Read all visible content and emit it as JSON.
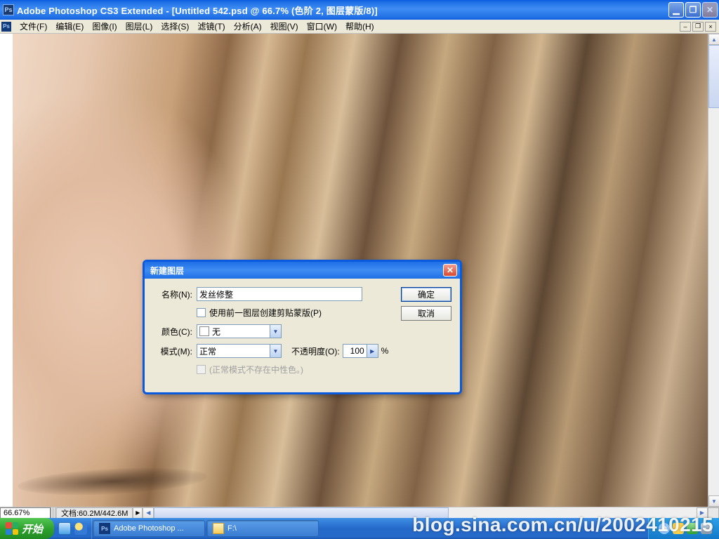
{
  "titlebar": {
    "app_icon": "Ps",
    "title": "Adobe Photoshop CS3 Extended - [Untitled 542.psd @ 66.7% (色阶 2, 图层蒙版/8)]"
  },
  "menu": {
    "items": [
      "文件(F)",
      "编辑(E)",
      "图像(I)",
      "图层(L)",
      "选择(S)",
      "滤镜(T)",
      "分析(A)",
      "视图(V)",
      "窗口(W)",
      "帮助(H)"
    ]
  },
  "status": {
    "zoom": "66.67%",
    "docinfo": "文档:60.2M/442.6M"
  },
  "dialog": {
    "title": "新建图层",
    "name_label": "名称(N):",
    "name_value": "发丝修整",
    "clip_label": "使用前一图层创建剪贴蒙版(P)",
    "color_label": "颜色(C):",
    "color_value": "无",
    "mode_label": "模式(M):",
    "mode_value": "正常",
    "opacity_label": "不透明度(O):",
    "opacity_value": "100",
    "opacity_suffix": "%",
    "neutral_label": "(正常模式不存在中性色。)",
    "ok": "确定",
    "cancel": "取消"
  },
  "taskbar": {
    "start": "开始",
    "tasks": [
      {
        "icon": "ps",
        "label": "Adobe Photoshop ..."
      },
      {
        "icon": "folder",
        "label": "F:\\"
      }
    ]
  },
  "watermark": "blog.sina.com.cn/u/2002410215"
}
